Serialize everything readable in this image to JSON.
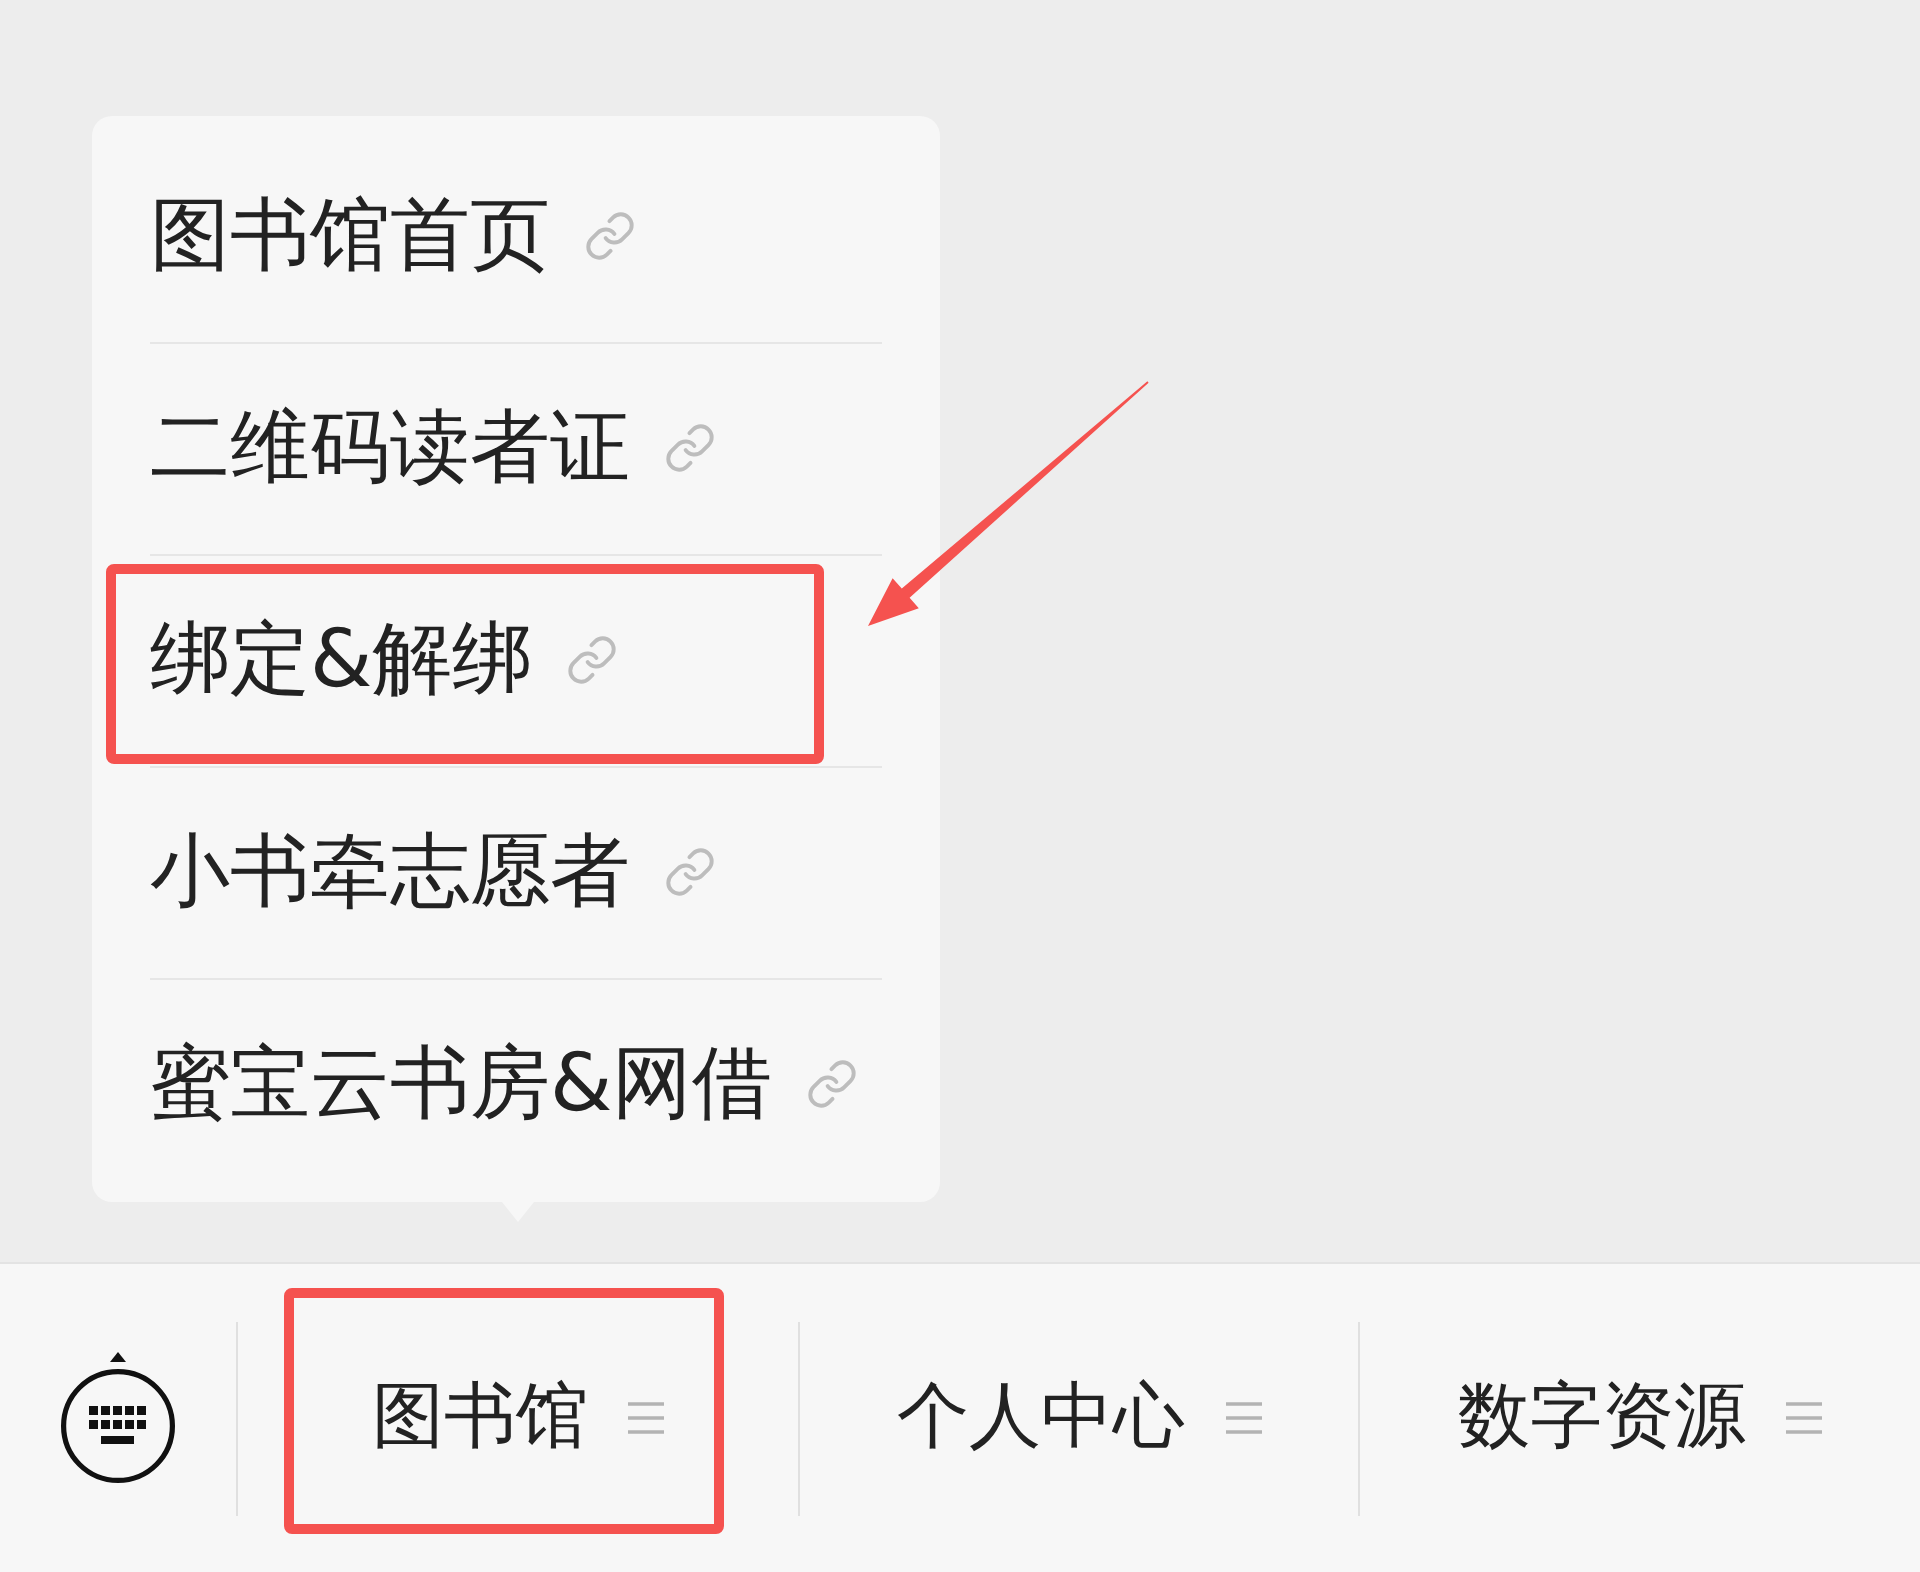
{
  "tab_bar": {
    "tabs": [
      {
        "label": "图书馆",
        "expanded": true,
        "highlighted": true,
        "menu": [
          {
            "label": "图书馆首页",
            "highlighted": false
          },
          {
            "label": "二维码读者证",
            "highlighted": false
          },
          {
            "label": "绑定&解绑",
            "highlighted": true
          },
          {
            "label": "小书牵志愿者",
            "highlighted": false
          },
          {
            "label": "蜜宝云书房&网借",
            "highlighted": false
          }
        ]
      },
      {
        "label": "个人中心",
        "expanded": false,
        "highlighted": false
      },
      {
        "label": "数字资源",
        "expanded": false,
        "highlighted": false
      }
    ]
  }
}
